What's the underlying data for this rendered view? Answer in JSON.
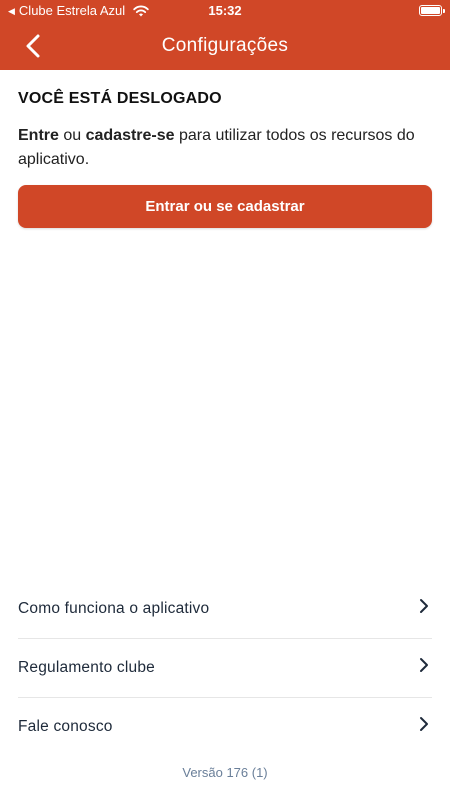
{
  "status_bar": {
    "carrier": "Clube Estrela Azul",
    "time": "15:32"
  },
  "header": {
    "title": "Configurações"
  },
  "logged_out": {
    "heading": "VOCÊ ESTÁ DESLOGADO",
    "desc_enter": "Entre",
    "desc_or": " ou ",
    "desc_register": "cadastre-se",
    "desc_rest": " para utilizar todos os recursos do aplicativo.",
    "button_label": "Entrar ou se cadastrar"
  },
  "menu": {
    "items": [
      {
        "label": "Como funciona o aplicativo"
      },
      {
        "label": "Regulamento clube"
      },
      {
        "label": "Fale conosco"
      }
    ]
  },
  "footer": {
    "version": "Versão 176 (1)"
  },
  "colors": {
    "primary": "#d04727",
    "text": "#1c1c1c",
    "muted": "#6a7f99"
  }
}
